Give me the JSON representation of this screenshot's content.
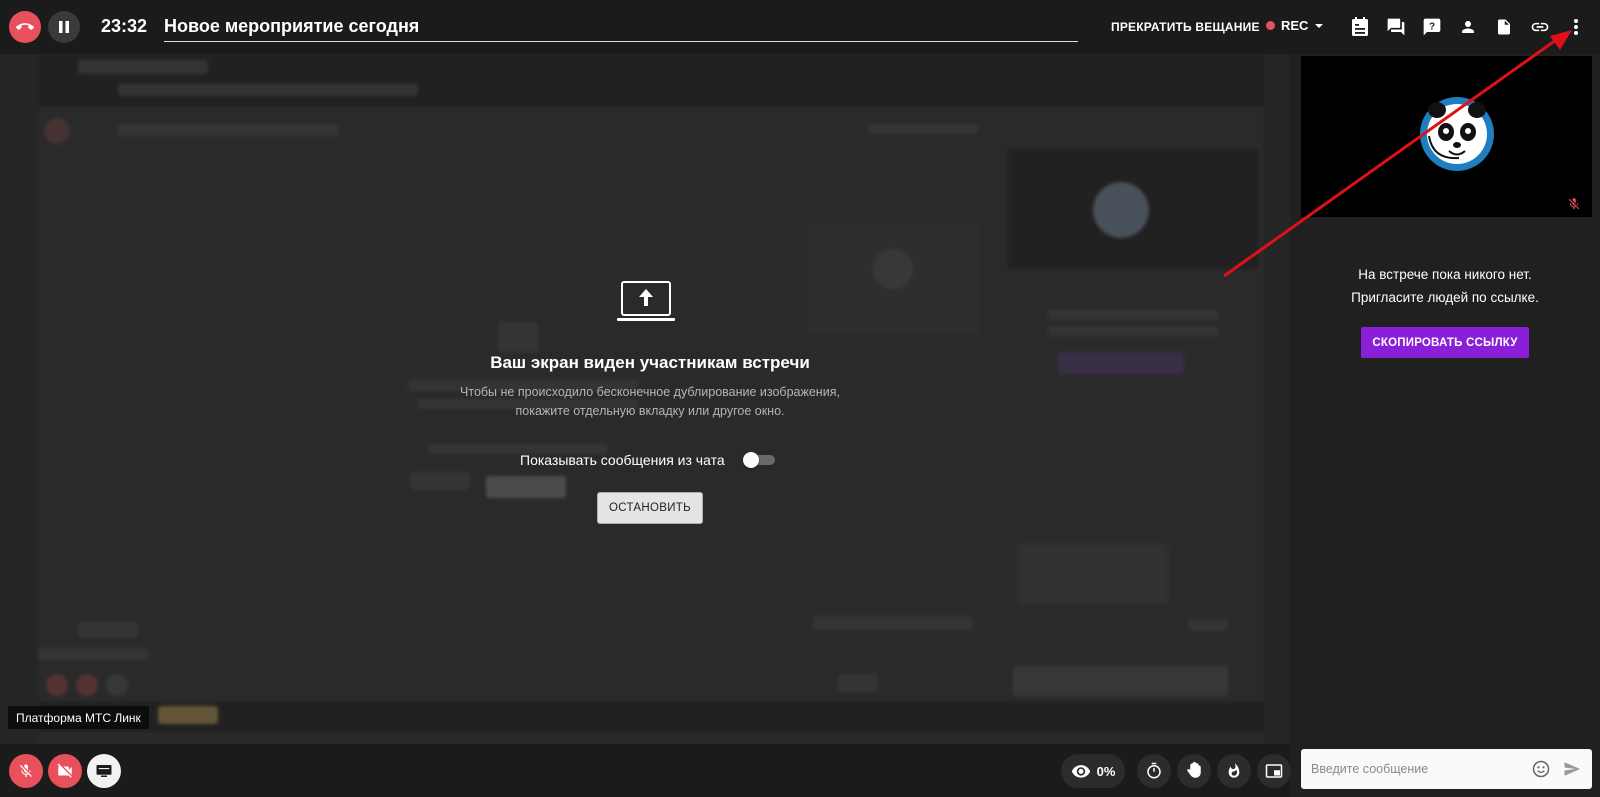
{
  "topbar": {
    "time": "23:32",
    "title": "Новое мероприятие сегодня",
    "stop_broadcast": "ПРЕКРАТИТЬ ВЕЩАНИЕ",
    "rec": "REC",
    "icons": [
      "end-call-icon",
      "pause-icon",
      "agenda-icon",
      "chat-icon",
      "questions-icon",
      "participants-icon",
      "file-icon",
      "link-icon",
      "more-vert-icon"
    ]
  },
  "share": {
    "title": "Ваш экран виден участникам встречи",
    "description_line1": "Чтобы не происходило бесконечное дублирование изображения,",
    "description_line2": "покажите отдельную вкладку или другое окно.",
    "chat_toggle_label": "Показывать сообщения из чата",
    "chat_toggle_on": false,
    "stop_button": "ОСТАНОВИТЬ"
  },
  "right_panel": {
    "empty_line1": "На встрече пока никого нет.",
    "empty_line2": "Пригласите людей по ссылке.",
    "copy_link_button": "СКОПИРОВАТЬ ССЫЛКУ",
    "chat_placeholder": "Введите сообщение"
  },
  "bottombar": {
    "tooltip": "Платформа МТС Линк",
    "viewers_percent": "0%",
    "icons": [
      "mic-off-icon",
      "camera-off-icon",
      "screen-share-icon",
      "eye-icon",
      "timer-icon",
      "raise-hand-icon",
      "fire-icon",
      "picture-in-picture-icon"
    ]
  },
  "colors": {
    "danger": "#e8505b",
    "accent_purple": "#8a1fd8",
    "annotation_arrow": "#e0101a"
  }
}
